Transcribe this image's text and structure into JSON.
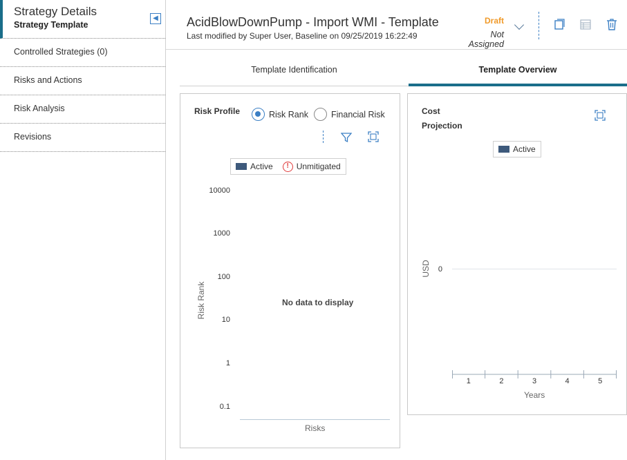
{
  "sidebar": {
    "title": "Strategy Details",
    "subtitle": "Strategy Template",
    "collapse_icon": "collapse-left-icon",
    "items": [
      {
        "label": "Controlled Strategies (0)"
      },
      {
        "label": "Risks and Actions"
      },
      {
        "label": "Risk Analysis"
      },
      {
        "label": "Revisions"
      }
    ]
  },
  "header": {
    "title": "AcidBlowDownPump - Import WMI - Template",
    "subtitle": "Last modified by Super User, Baseline on 09/25/2019 16:22:49",
    "status": "Draft",
    "assignment": "Not Assigned",
    "icons": [
      "copy-icon",
      "grid-icon",
      "trash-icon"
    ]
  },
  "tabs": [
    {
      "label": "Template Identification",
      "active": false
    },
    {
      "label": "Template Overview",
      "active": true
    }
  ],
  "risk_profile": {
    "title": "Risk Profile",
    "radios": [
      {
        "label": "Risk Rank",
        "selected": true
      },
      {
        "label": "Financial Risk",
        "selected": false
      }
    ],
    "legend": [
      {
        "label": "Active",
        "color": "#3e5a7c"
      },
      {
        "label": "Unmitigated",
        "icon": "warning-icon",
        "color": "#e03a3a"
      }
    ],
    "message": "No data to display"
  },
  "cost_projection": {
    "title_line1": "Cost",
    "title_line2": "Projection",
    "legend": [
      {
        "label": "Active",
        "color": "#3e5a7c"
      }
    ]
  },
  "chart_data": [
    {
      "type": "bar",
      "title": "Risk Profile",
      "ylabel": "Risk Rank",
      "xlabel": "Risks",
      "yscale": "log",
      "yticks": [
        "10000",
        "1000",
        "100",
        "10",
        "1",
        "0.1"
      ],
      "categories": [],
      "series": [],
      "message": "No data to display"
    },
    {
      "type": "bar",
      "title": "Cost Projection",
      "ylabel": "USD",
      "xlabel": "Years",
      "yticks": [
        "0"
      ],
      "categories": [
        "1",
        "2",
        "3",
        "4",
        "5"
      ],
      "series": [
        {
          "name": "Active",
          "values": [
            0,
            0,
            0,
            0,
            0
          ]
        }
      ]
    }
  ]
}
